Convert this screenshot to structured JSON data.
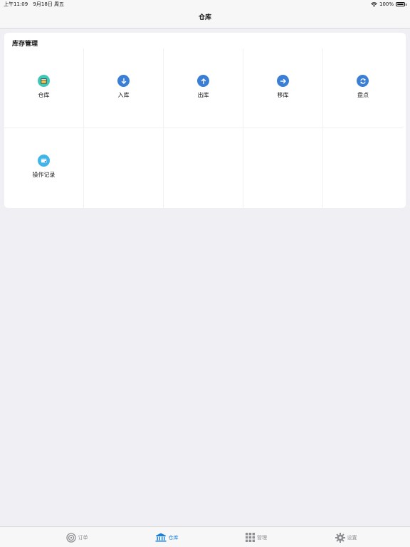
{
  "status_bar": {
    "time": "上午11:09",
    "date": "9月18日 周五",
    "battery": "100%"
  },
  "nav": {
    "title": "仓库"
  },
  "section": {
    "title": "库存管理",
    "items": [
      {
        "label": "仓库",
        "icon": "warehouse-icon",
        "color": "#3fc7b8"
      },
      {
        "label": "入库",
        "icon": "arrow-down-icon",
        "color": "#3a7fd5"
      },
      {
        "label": "出库",
        "icon": "arrow-up-icon",
        "color": "#3a7fd5"
      },
      {
        "label": "移库",
        "icon": "arrow-right-icon",
        "color": "#3a7fd5"
      },
      {
        "label": "盘点",
        "icon": "refresh-icon",
        "color": "#3a7fd5"
      },
      {
        "label": "操作记录",
        "icon": "record-icon",
        "color": "#3fb5e8"
      }
    ]
  },
  "tab_bar": {
    "tabs": [
      {
        "label": "订单",
        "icon": "target-icon",
        "active": false
      },
      {
        "label": "仓库",
        "icon": "bank-icon",
        "active": true
      },
      {
        "label": "管理",
        "icon": "grid-icon",
        "active": false
      },
      {
        "label": "设置",
        "icon": "gear-icon",
        "active": false
      }
    ],
    "active_color": "#1a7fd9",
    "inactive_color": "#8e8e93"
  }
}
